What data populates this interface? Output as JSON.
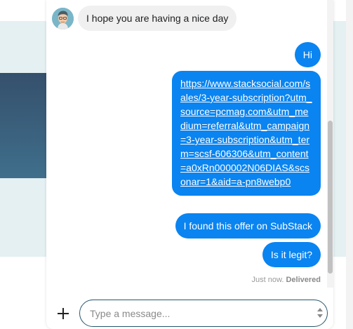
{
  "conversation": {
    "incoming": [
      {
        "text": "I hope you are having a nice day"
      }
    ],
    "outgoing": [
      {
        "text": "Hi"
      },
      {
        "text": "https://www.stacksocial.com/sales/3-year-subscription?utm_source=pcmag.com&utm_medium=referral&utm_campaign=3-year-subscription&utm_term=scsf-606306&utm_content=a0xRn000002N06DIAS&scsonar=1&aid=a-pn8webp0",
        "is_link": true
      },
      {
        "text": "I found this offer on SubStack"
      },
      {
        "text": "Is it legit?"
      }
    ],
    "status": {
      "time": "Just now.",
      "state": "Delivered"
    }
  },
  "composer": {
    "placeholder": "Type a message...",
    "add_icon": "plus-icon"
  },
  "colors": {
    "outgoing_bubble": "#0a84f0",
    "incoming_bubble": "#f1f0f0",
    "composer_border": "#26566e"
  }
}
